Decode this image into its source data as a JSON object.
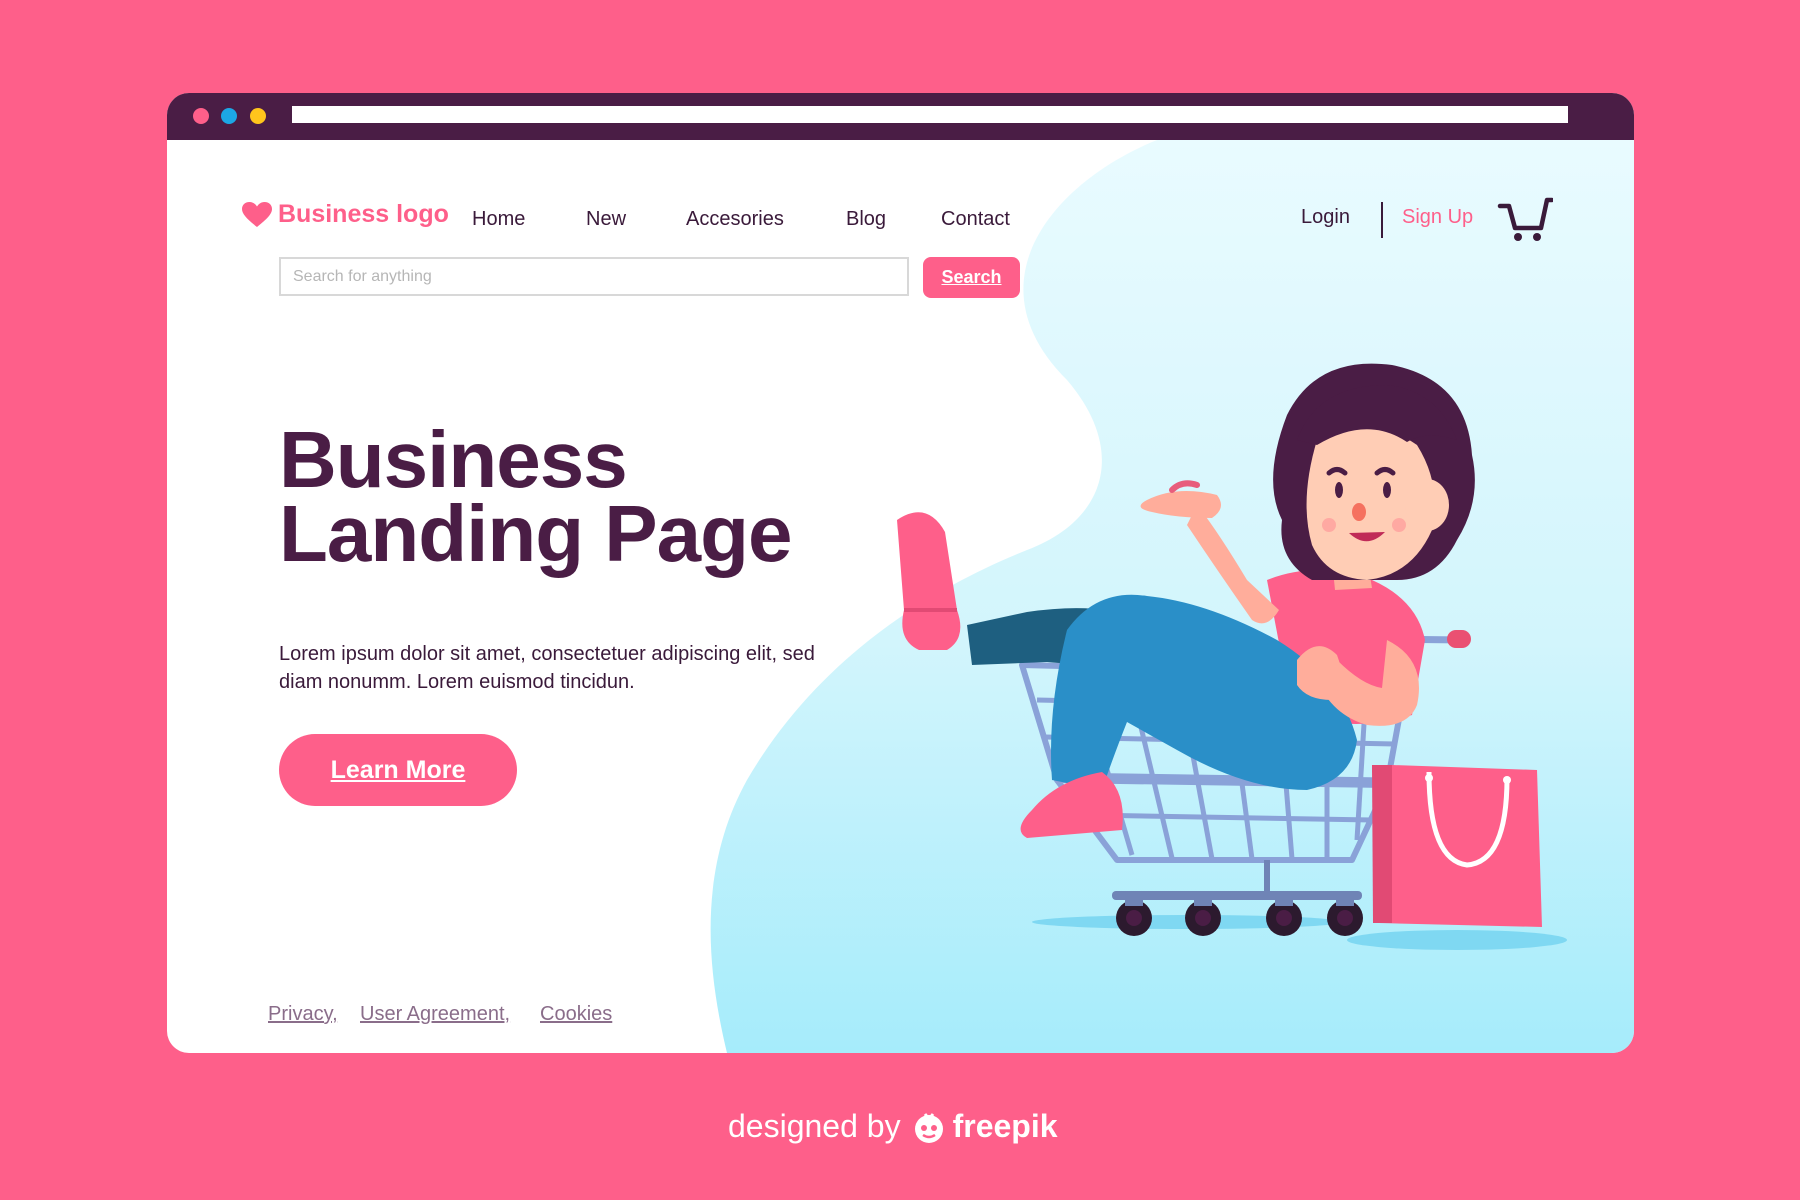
{
  "colors": {
    "background": "#fe5f8a",
    "accent": "#fe5f8a",
    "dark": "#4a1d45",
    "light_blue": "#d9f8ff"
  },
  "window": {
    "controls": [
      "red",
      "blue",
      "yellow"
    ]
  },
  "header": {
    "logo_icon": "heart-icon",
    "logo_text": "Business logo",
    "nav": [
      "Home",
      "New",
      "Accesories",
      "Blog",
      "Contact"
    ],
    "login": "Login",
    "signup": "Sign Up",
    "cart_icon": "shopping-cart-icon"
  },
  "search": {
    "placeholder": "Search for anything",
    "button": "Search"
  },
  "hero": {
    "title_line1": "Business",
    "title_line2": "Landing Page",
    "description": "Lorem ipsum dolor sit amet, consectetuer adipiscing elit, sed diam nonumm. Lorem euismod tincidun.",
    "cta": "Learn More"
  },
  "footer": {
    "links": [
      "Privacy,",
      "User Agreement,",
      "Cookies"
    ]
  },
  "credit": {
    "prefix": "designed by",
    "brand": "freepik"
  }
}
